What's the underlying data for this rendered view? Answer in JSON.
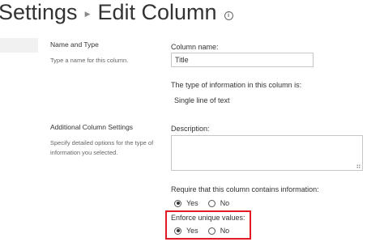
{
  "breadcrumb": {
    "parent": "Settings",
    "current": "Edit Column",
    "info_icon": "info-icon"
  },
  "name_type_section": {
    "title": "Name and Type",
    "description": "Type a name for this column.",
    "column_name_label": "Column name:",
    "column_name_value": "Title",
    "type_label": "The type of information in this column is:",
    "type_value": "Single line of text"
  },
  "additional_section": {
    "title": "Additional Column Settings",
    "description_line1": "Specify detailed options for the type of",
    "description_line2": "information you selected.",
    "description_label": "Description:",
    "description_value": "",
    "require_label": "Require that this column contains information:",
    "require_options": [
      {
        "label": "Yes",
        "selected": true
      },
      {
        "label": "No",
        "selected": false
      }
    ],
    "unique_label": "Enforce unique values:",
    "unique_options": [
      {
        "label": "Yes",
        "selected": true
      },
      {
        "label": "No",
        "selected": false
      }
    ]
  },
  "colors": {
    "highlight": "#e01b24",
    "text": "#333333",
    "muted": "#666666"
  }
}
